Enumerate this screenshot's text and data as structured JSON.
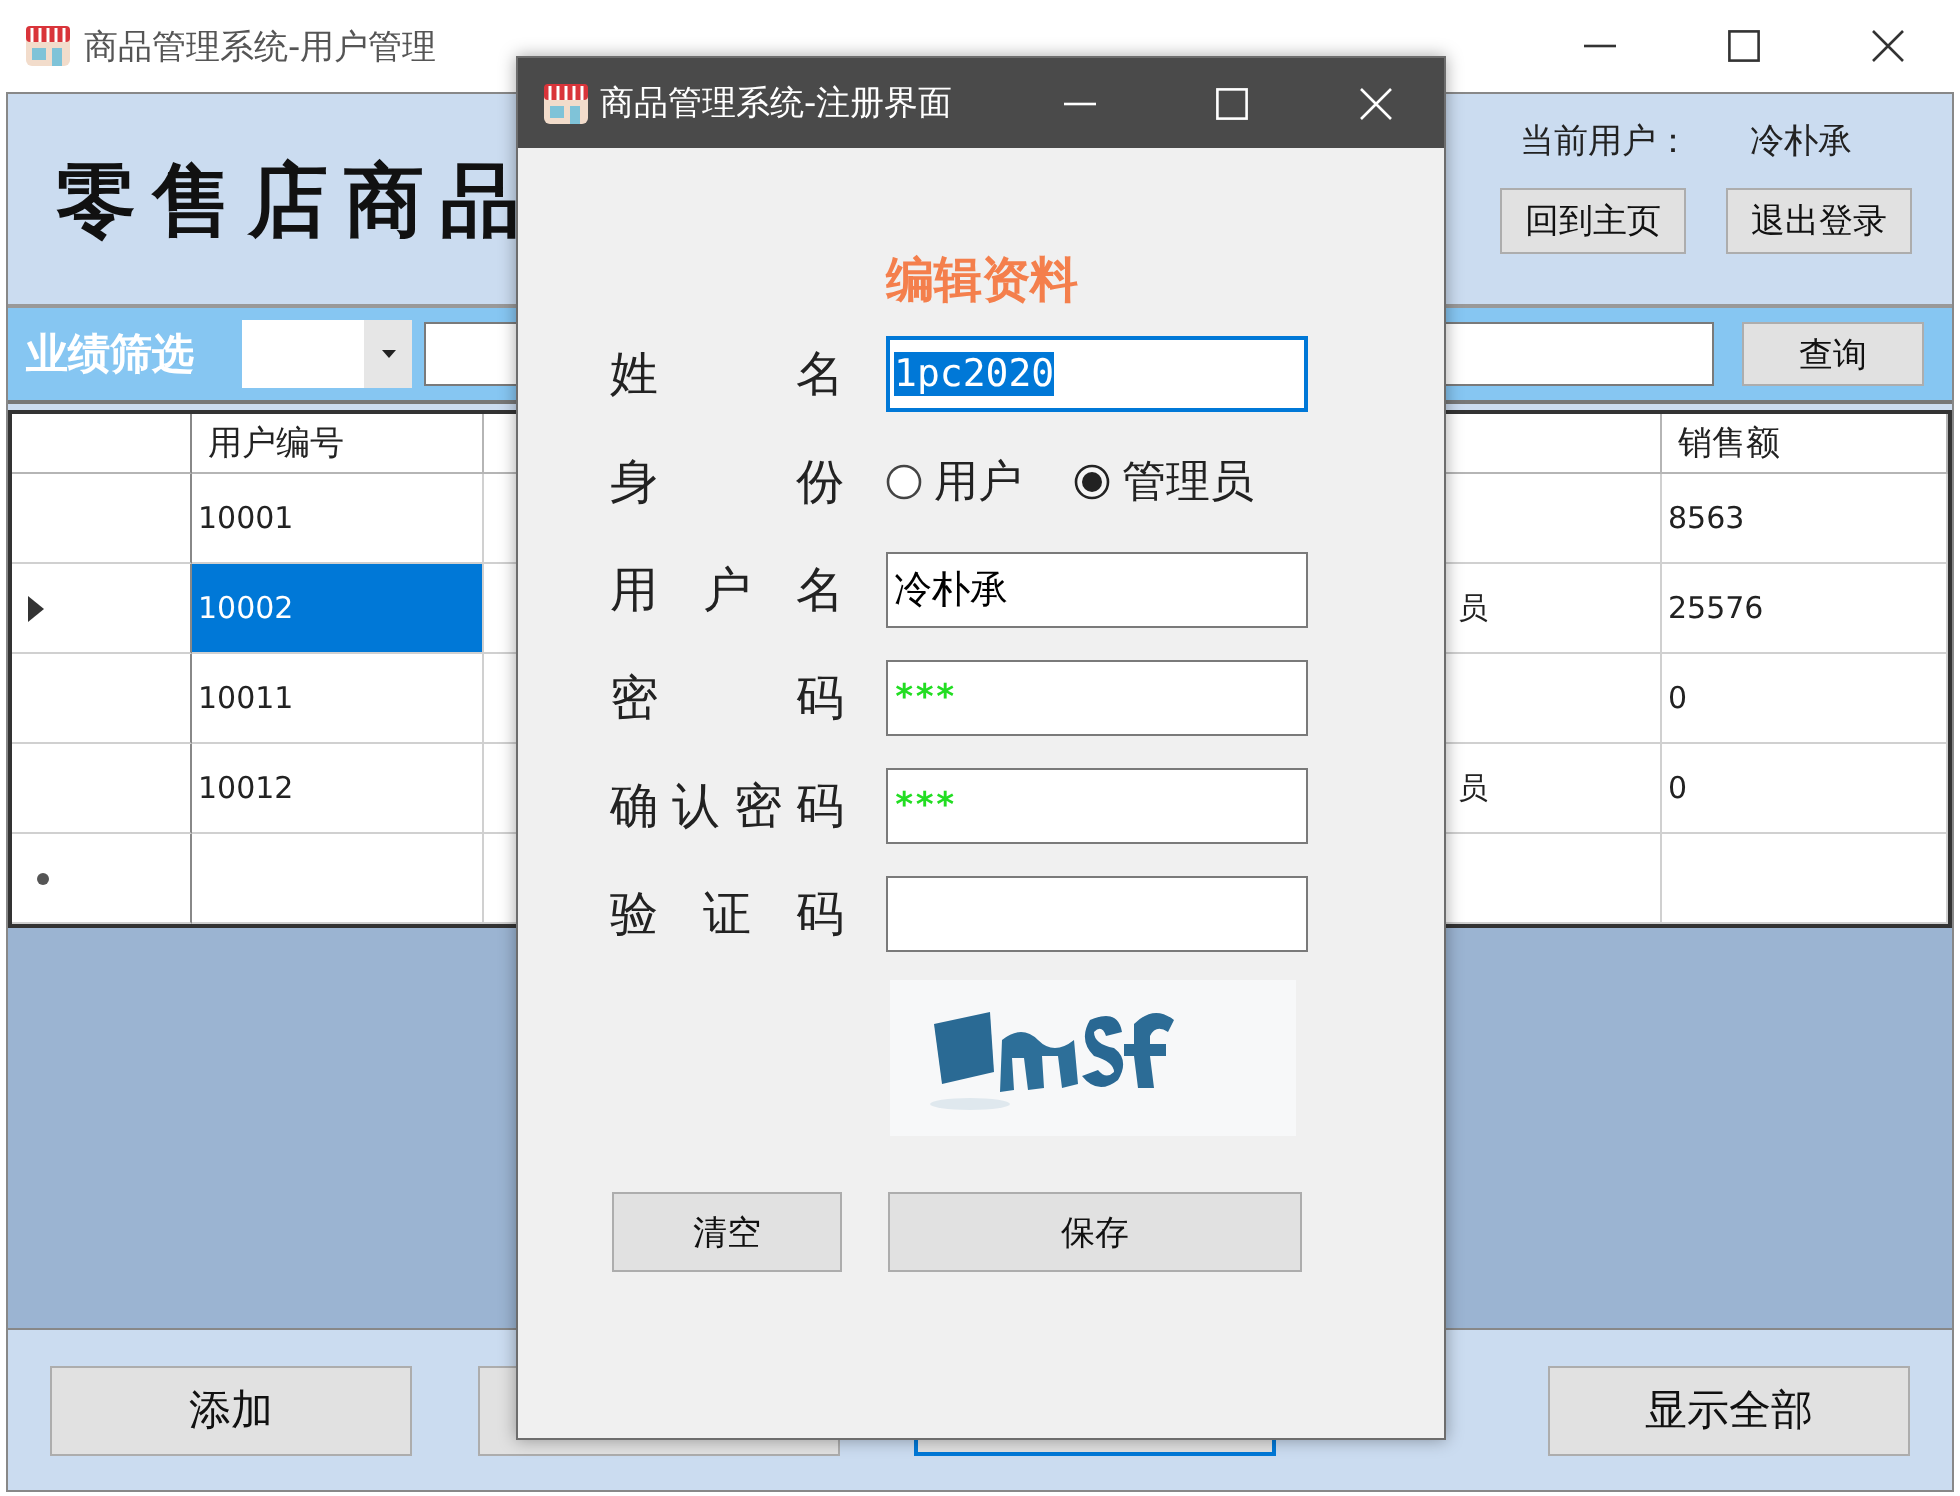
{
  "window": {
    "title": "商品管理系统-用户管理"
  },
  "header": {
    "logo_text": "零售店商品",
    "current_user_label": "当前用户：",
    "current_user": "冷朴承",
    "buttons": [
      "回到主页",
      "退出登录"
    ]
  },
  "filter_bar": {
    "label": "业绩筛选",
    "query_button": "查询"
  },
  "table": {
    "columns": [
      "用户编号",
      "销售额"
    ],
    "rows": [
      {
        "kind": "data",
        "selected": false,
        "id": "10001",
        "sales": "8563"
      },
      {
        "kind": "data",
        "selected": true,
        "id": "10002",
        "column_4": "员",
        "sales": "25576"
      },
      {
        "kind": "data",
        "selected": false,
        "id": "10011",
        "sales": "0"
      },
      {
        "kind": "data",
        "selected": false,
        "id": "10012",
        "column_4": "员",
        "sales": "0"
      },
      {
        "kind": "new"
      }
    ]
  },
  "bottom_buttons": [
    {
      "label": "添加",
      "focused": false
    },
    {
      "focused": false
    },
    {
      "focused": true
    },
    {
      "label": "显示全部",
      "focused": false
    }
  ],
  "dialog": {
    "title": "商品管理系统-注册界面",
    "heading": "编辑资料",
    "fields": [
      {
        "kind": "text",
        "label": "姓名",
        "value": "1pc2020",
        "focused": true
      },
      {
        "kind": "radio",
        "label": "身份",
        "options": [
          {
            "label": "用户",
            "selected": false
          },
          {
            "label": "管理员",
            "selected": true
          }
        ]
      },
      {
        "kind": "text",
        "label": "用户名",
        "value": "冷朴承",
        "focused": false
      },
      {
        "kind": "password",
        "label": "密码",
        "value": "***",
        "focused": false
      },
      {
        "kind": "password",
        "label": "确认密码",
        "value": "***",
        "focused": false
      },
      {
        "kind": "text",
        "label": "验证码",
        "focused": false
      }
    ],
    "buttons": [
      "清空",
      "保存"
    ]
  }
}
